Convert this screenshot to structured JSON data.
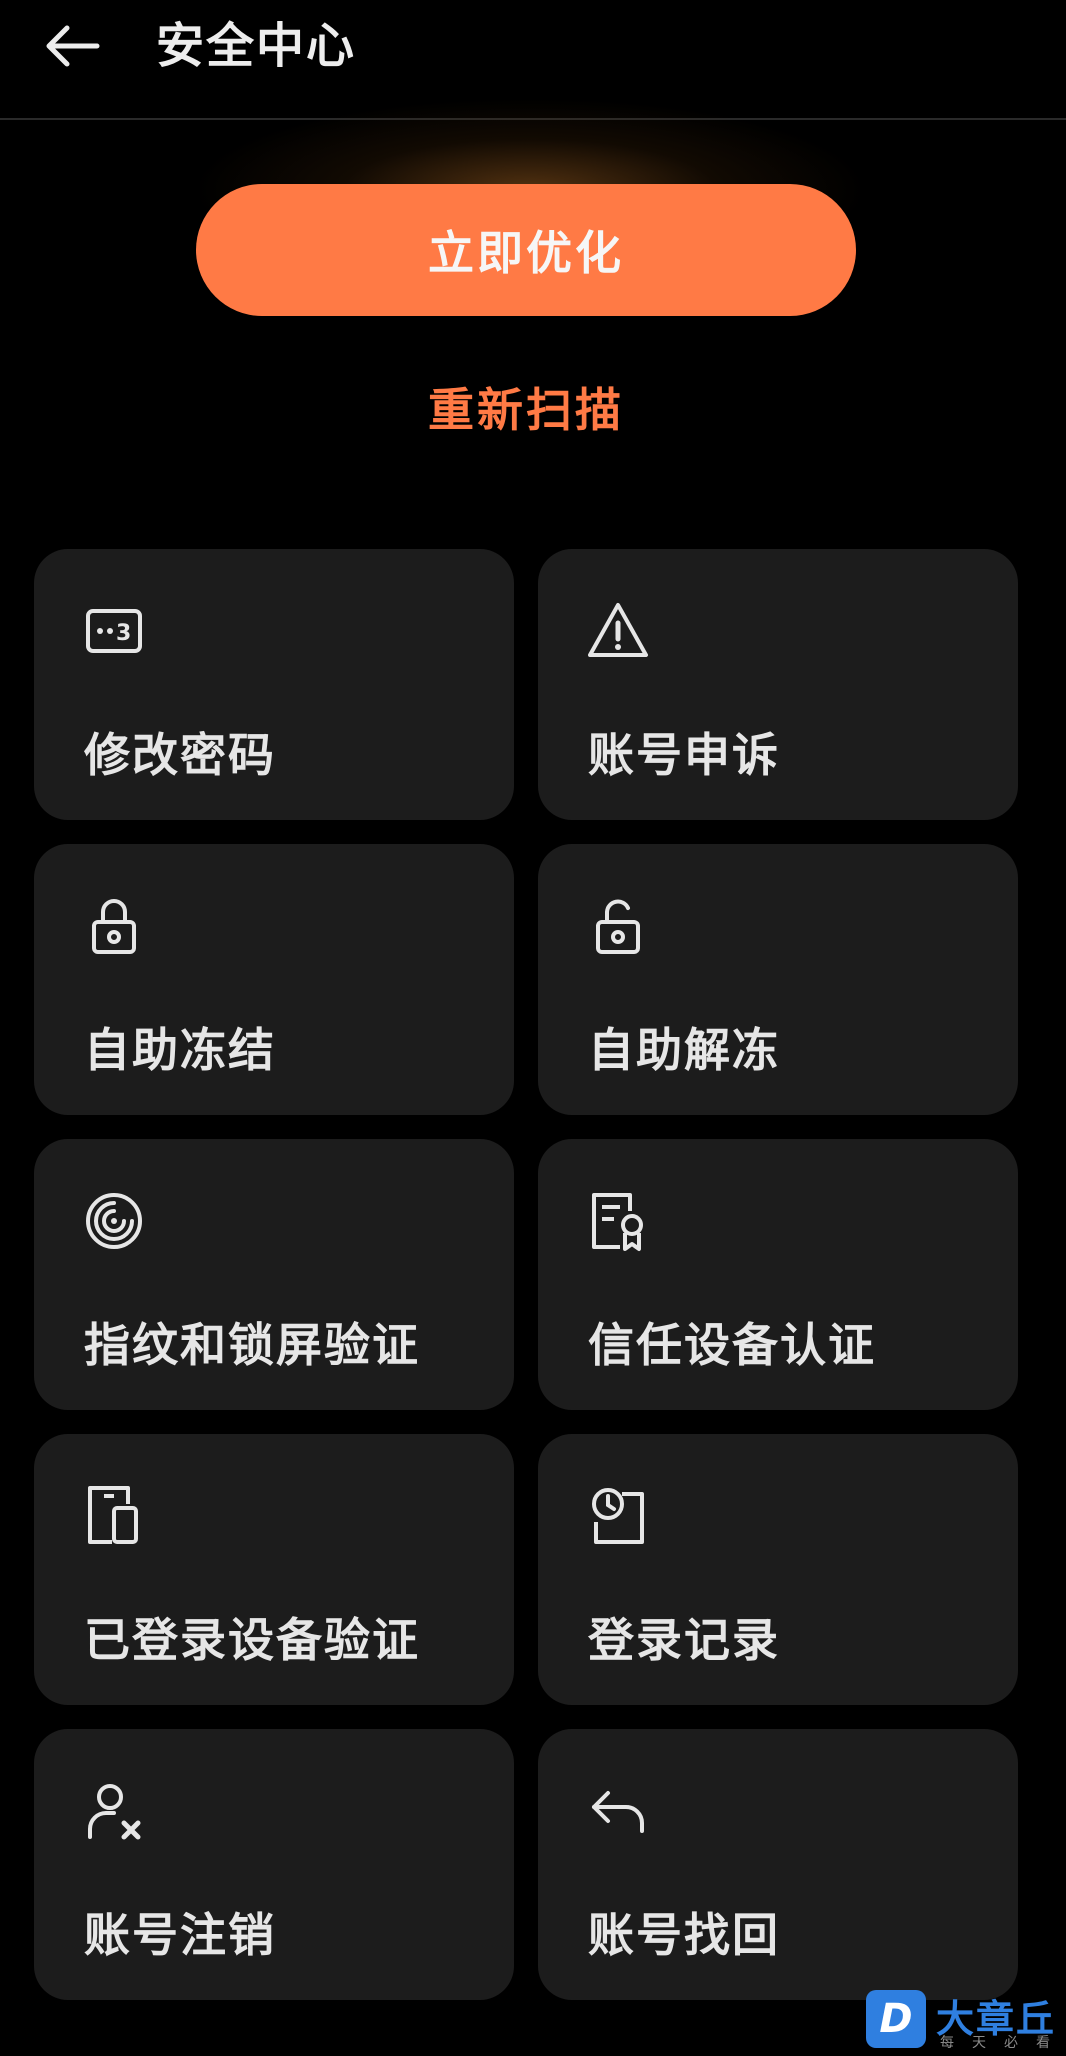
{
  "header": {
    "title": "安全中心",
    "back_icon": "arrow-left-icon"
  },
  "actions": {
    "optimize_label": "立即优化",
    "rescan_label": "重新扫描",
    "accent_color": "#ff7a45"
  },
  "cards": [
    {
      "label": "修改密码",
      "icon": "password-icon"
    },
    {
      "label": "账号申诉",
      "icon": "warning-icon"
    },
    {
      "label": "自助冻结",
      "icon": "lock-icon"
    },
    {
      "label": "自助解冻",
      "icon": "unlock-icon"
    },
    {
      "label": "指纹和锁屏验证",
      "icon": "fingerprint-icon"
    },
    {
      "label": "信任设备认证",
      "icon": "certificate-icon"
    },
    {
      "label": "已登录设备验证",
      "icon": "devices-icon"
    },
    {
      "label": "登录记录",
      "icon": "clock-history-icon"
    },
    {
      "label": "账号注销",
      "icon": "user-remove-icon"
    },
    {
      "label": "账号找回",
      "icon": "reply-icon"
    }
  ],
  "watermark": {
    "logo_letter": "D",
    "name": "大章丘",
    "slogan": "每天必看"
  }
}
